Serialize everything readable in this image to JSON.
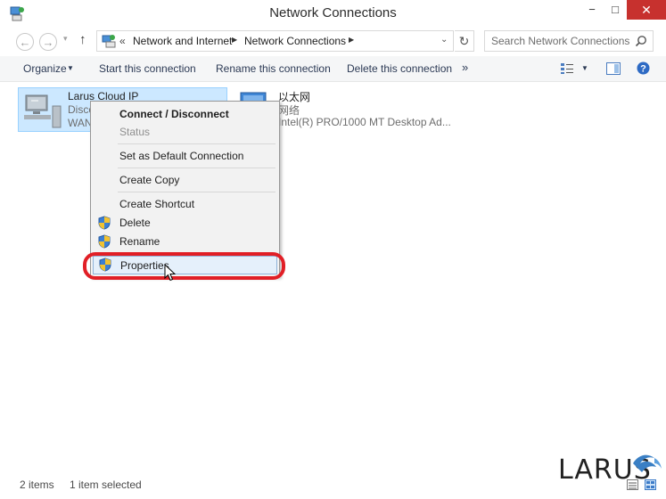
{
  "window": {
    "title": "Network Connections",
    "controls": {
      "minimize": "−",
      "maximize": "□",
      "close": "✕"
    }
  },
  "navigation": {
    "back_glyph": "←",
    "forward_glyph": "→",
    "recent_glyph": "▾",
    "up_glyph": "↑",
    "breadcrumb_overflow": "«",
    "breadcrumbs": [
      "Network and Internet",
      "Network Connections"
    ],
    "breadcrumb_separator": "▶",
    "dropdown_glyph": "⌄",
    "refresh_glyph": "↻",
    "search_placeholder": "Search Network Connections"
  },
  "commandbar": {
    "organize": "Organize",
    "organize_arrow": "▼",
    "start": "Start this connection",
    "rename": "Rename this connection",
    "delete": "Delete this connection",
    "more": "»",
    "view_arrow": "▼"
  },
  "connections": [
    {
      "name": "Larus Cloud IP",
      "status": "Disco",
      "device": "WAN",
      "selected": true,
      "icon": "vpn-connection-icon"
    },
    {
      "name": "以太网",
      "status": "网络",
      "device": "Intel(R) PRO/1000 MT Desktop Ad...",
      "selected": false,
      "icon": "ethernet-adapter-icon"
    }
  ],
  "context_menu": {
    "connect": "Connect / Disconnect",
    "status": "Status",
    "set_default": "Set as Default Connection",
    "create_copy": "Create Copy",
    "create_shortcut": "Create Shortcut",
    "delete": "Delete",
    "rename": "Rename",
    "properties": "Properties",
    "shield_icon": "uac-shield-icon",
    "highlighted": "Properties",
    "annotation_color": "#e11f26"
  },
  "statusbar": {
    "item_count": "2 items",
    "selected_count": "1 item selected"
  },
  "watermark": {
    "logo_text": "LARUS",
    "logo_color": "#3a7fc4"
  },
  "colors": {
    "close_button": "#c7312e",
    "selection_fill": "#cce8ff",
    "selection_border": "#99d1ff",
    "command_text": "#2c3a55"
  }
}
